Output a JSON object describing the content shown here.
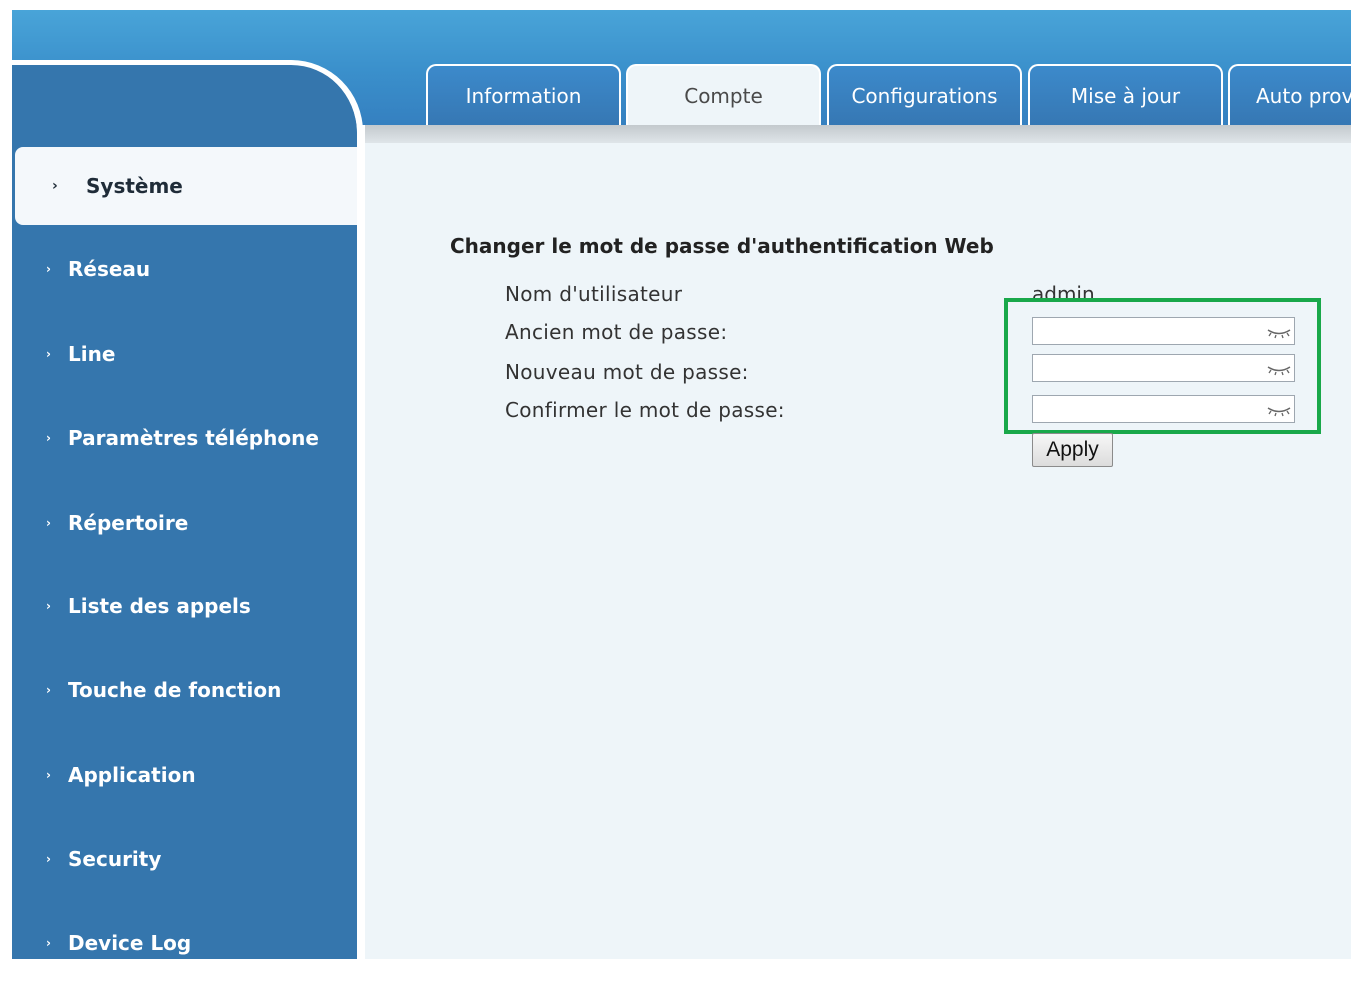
{
  "tabs": [
    {
      "label": "Information",
      "active": false
    },
    {
      "label": "Compte",
      "active": true
    },
    {
      "label": "Configurations",
      "active": false
    },
    {
      "label": "Mise à jour",
      "active": false
    },
    {
      "label": "Auto prov",
      "active": false
    }
  ],
  "sidebar": {
    "items": [
      {
        "label": "Système",
        "active": true
      },
      {
        "label": "Réseau"
      },
      {
        "label": "Line"
      },
      {
        "label": "Paramètres téléphone"
      },
      {
        "label": "Répertoire"
      },
      {
        "label": "Liste des appels"
      },
      {
        "label": "Touche de fonction"
      },
      {
        "label": "Application"
      },
      {
        "label": "Security"
      },
      {
        "label": "Device Log"
      }
    ]
  },
  "form": {
    "title": "Changer le mot de passe d'authentification Web",
    "username_label": "Nom d'utilisateur",
    "username_value": "admin",
    "old_password_label": "Ancien mot de passe:",
    "new_password_label": "Nouveau mot de passe:",
    "confirm_password_label": "Confirmer le mot de passe:",
    "old_password_value": "",
    "new_password_value": "",
    "confirm_password_value": "",
    "apply_label": "Apply"
  },
  "icons": {
    "nav_bullet": "chevron-right-icon",
    "password_toggle": "eye-closed-icon"
  },
  "colors": {
    "header_blue": "#3a8fcb",
    "sidebar_blue": "#3576ad",
    "content_bg": "#eef5f9",
    "highlight_green": "#19a84a"
  }
}
